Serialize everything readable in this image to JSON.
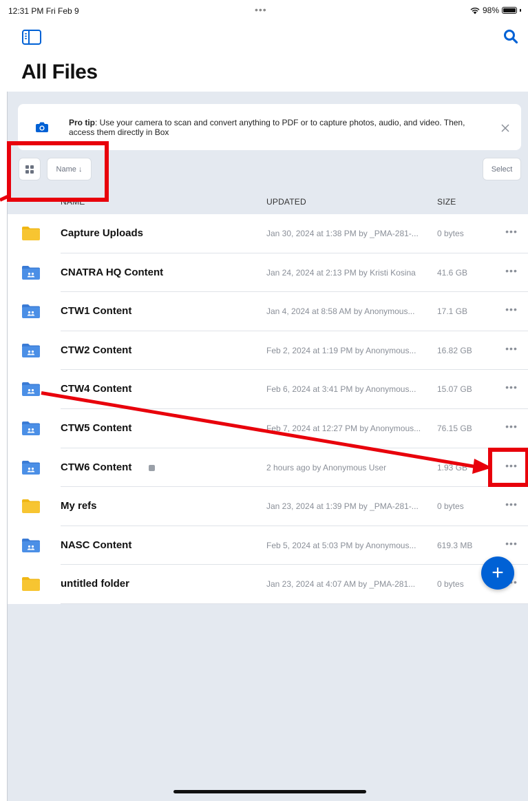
{
  "status": {
    "time": "12:31 PM  Fri Feb 9",
    "dots": "•••",
    "battery": "98%"
  },
  "header": {
    "title": "All Files"
  },
  "tip": {
    "label": "Pro tip",
    "text": ": Use your camera to scan and convert anything to PDF or to capture photos, audio, and video. Then, access them directly in Box"
  },
  "controls": {
    "sort_label": "Name ↓",
    "select_label": "Select"
  },
  "columns": {
    "name": "NAME",
    "updated": "UPDATED",
    "size": "SIZE"
  },
  "files": [
    {
      "name": "Capture Uploads",
      "updated": "Jan 30, 2024 at 1:38 PM by _PMA-281-...",
      "size": "0 bytes",
      "icon": "folder-icon",
      "more": "•••"
    },
    {
      "name": "CNATRA HQ Content",
      "updated": "Jan 24, 2024 at 2:13 PM by Kristi Kosina",
      "size": "41.6 GB",
      "icon": "shared-folder-icon",
      "more": "•••"
    },
    {
      "name": "CTW1 Content",
      "updated": "Jan 4, 2024 at 8:58 AM by Anonymous...",
      "size": "17.1 GB",
      "icon": "shared-folder-icon",
      "more": "•••"
    },
    {
      "name": "CTW2 Content",
      "updated": "Feb 2, 2024 at 1:19 PM by Anonymous...",
      "size": "16.82 GB",
      "icon": "shared-folder-icon",
      "more": "•••"
    },
    {
      "name": "CTW4 Content",
      "updated": "Feb 6, 2024 at 3:41 PM by Anonymous...",
      "size": "15.07 GB",
      "icon": "shared-folder-icon",
      "more": "•••"
    },
    {
      "name": "CTW5 Content",
      "updated": "Feb 7, 2024 at 12:27 PM by Anonymous...",
      "size": "76.15 GB",
      "icon": "shared-folder-icon",
      "more": "•••"
    },
    {
      "name": "CTW6 Content",
      "updated": "2 hours ago by Anonymous User",
      "size": "1.93 GB",
      "icon": "shared-folder-icon",
      "more": "•••"
    },
    {
      "name": "My refs",
      "updated": "Jan 23, 2024 at 1:39 PM by _PMA-281-...",
      "size": "0 bytes",
      "icon": "folder-icon",
      "more": "•••"
    },
    {
      "name": "NASC Content",
      "updated": "Feb 5, 2024 at 5:03 PM by Anonymous...",
      "size": "619.3 MB",
      "icon": "shared-folder-icon",
      "more": "•••"
    },
    {
      "name": "untitled folder",
      "updated": "Jan 23, 2024 at 4:07 AM by _PMA-281...",
      "size": "0 bytes",
      "icon": "folder-icon",
      "more": "•••"
    }
  ],
  "fab": {
    "label": "+"
  },
  "colors": {
    "accent": "#0061d5",
    "annotation": "#e8000b",
    "background": "#e4e9f0"
  }
}
